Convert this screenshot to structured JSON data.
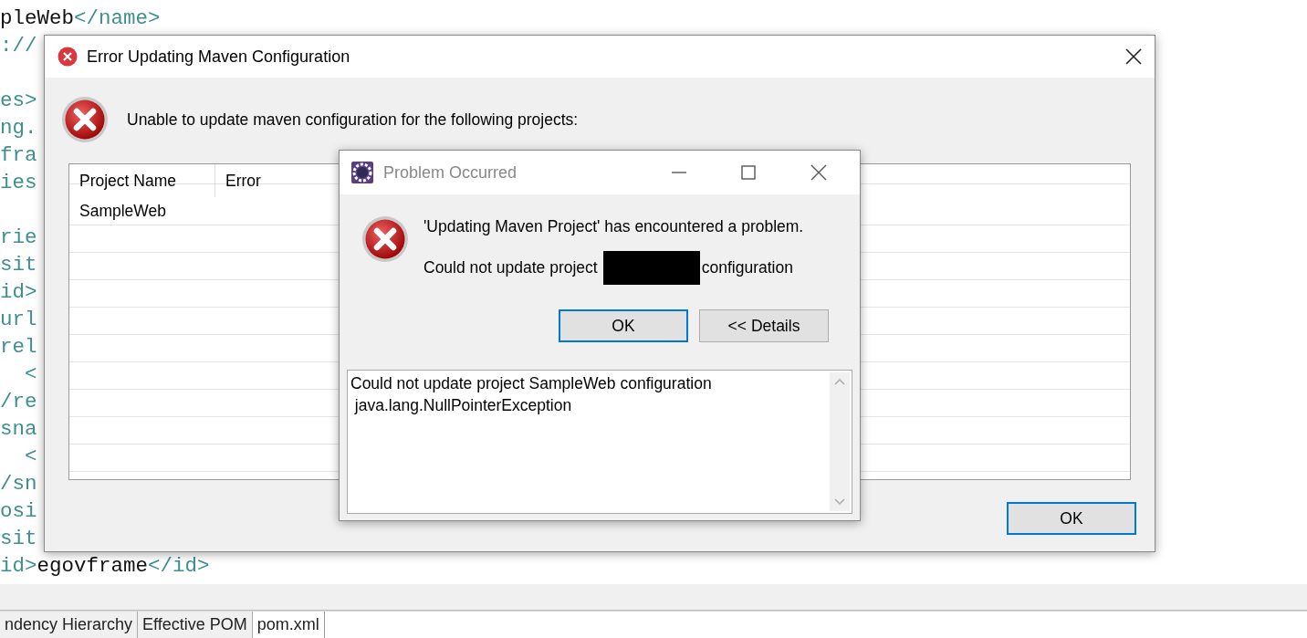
{
  "editor": {
    "lines": [
      {
        "kind": "code",
        "segments": [
          {
            "text": "pleWeb",
            "kind": "text"
          },
          {
            "text": "</name>",
            "kind": "tag"
          }
        ]
      },
      {
        "kind": "code",
        "segments": [
          {
            "text": "://",
            "kind": "tag"
          }
        ]
      },
      {
        "kind": "blank"
      },
      {
        "kind": "code",
        "segments": [
          {
            "text": "es>",
            "kind": "tag"
          }
        ]
      },
      {
        "kind": "code",
        "segments": [
          {
            "text": "ng.",
            "kind": "tag"
          }
        ]
      },
      {
        "kind": "code",
        "segments": [
          {
            "text": "fra",
            "kind": "tag"
          }
        ]
      },
      {
        "kind": "code",
        "segments": [
          {
            "text": "ies",
            "kind": "tag"
          }
        ]
      },
      {
        "kind": "blank"
      },
      {
        "kind": "code",
        "segments": [
          {
            "text": "rie",
            "kind": "tag"
          }
        ]
      },
      {
        "kind": "code",
        "segments": [
          {
            "text": "sit",
            "kind": "tag"
          }
        ]
      },
      {
        "kind": "code",
        "segments": [
          {
            "text": "id>",
            "kind": "tag"
          }
        ]
      },
      {
        "kind": "code",
        "segments": [
          {
            "text": "url",
            "kind": "tag"
          }
        ]
      },
      {
        "kind": "code",
        "segments": [
          {
            "text": "rel",
            "kind": "tag"
          }
        ]
      },
      {
        "kind": "code",
        "segments": [
          {
            "text": "  <",
            "kind": "tag"
          }
        ]
      },
      {
        "kind": "code",
        "segments": [
          {
            "text": "/re",
            "kind": "tag"
          }
        ]
      },
      {
        "kind": "code",
        "segments": [
          {
            "text": "sna",
            "kind": "tag"
          }
        ]
      },
      {
        "kind": "code",
        "segments": [
          {
            "text": "  <",
            "kind": "tag"
          }
        ]
      },
      {
        "kind": "code",
        "segments": [
          {
            "text": "/sn",
            "kind": "tag"
          }
        ]
      },
      {
        "kind": "code",
        "segments": [
          {
            "text": "osi",
            "kind": "tag"
          }
        ]
      },
      {
        "kind": "code",
        "segments": [
          {
            "text": "sit",
            "kind": "tag"
          }
        ]
      },
      {
        "kind": "code",
        "segments": [
          {
            "text": "id>",
            "kind": "tag"
          },
          {
            "text": "egovframe",
            "kind": "text"
          },
          {
            "text": "</id>",
            "kind": "tag"
          }
        ]
      }
    ]
  },
  "editor_tabs": [
    {
      "label": "ndency Hierarchy",
      "selected": false
    },
    {
      "label": "Effective POM",
      "selected": false
    },
    {
      "label": "pom.xml",
      "selected": true
    }
  ],
  "error_dialog": {
    "title": "Error Updating Maven Configuration",
    "message": "Unable to update maven configuration for the following projects:",
    "table": {
      "columns": [
        "Project Name",
        "Error"
      ],
      "rows": [
        [
          "SampleWeb",
          ""
        ]
      ]
    },
    "buttons": [
      "OK"
    ]
  },
  "problem_dialog": {
    "title": "Problem Occurred",
    "active": false,
    "heading": "'Updating Maven Project' has encountered a problem.",
    "detail_before": "Could not update project",
    "detail_after": "configuration",
    "redacted": true,
    "buttons": [
      {
        "label": "OK",
        "default": true
      },
      {
        "label": "<< Details",
        "default": false
      }
    ],
    "details": [
      "Could not update project SampleWeb configuration",
      " java.lang.NullPointerException"
    ]
  }
}
